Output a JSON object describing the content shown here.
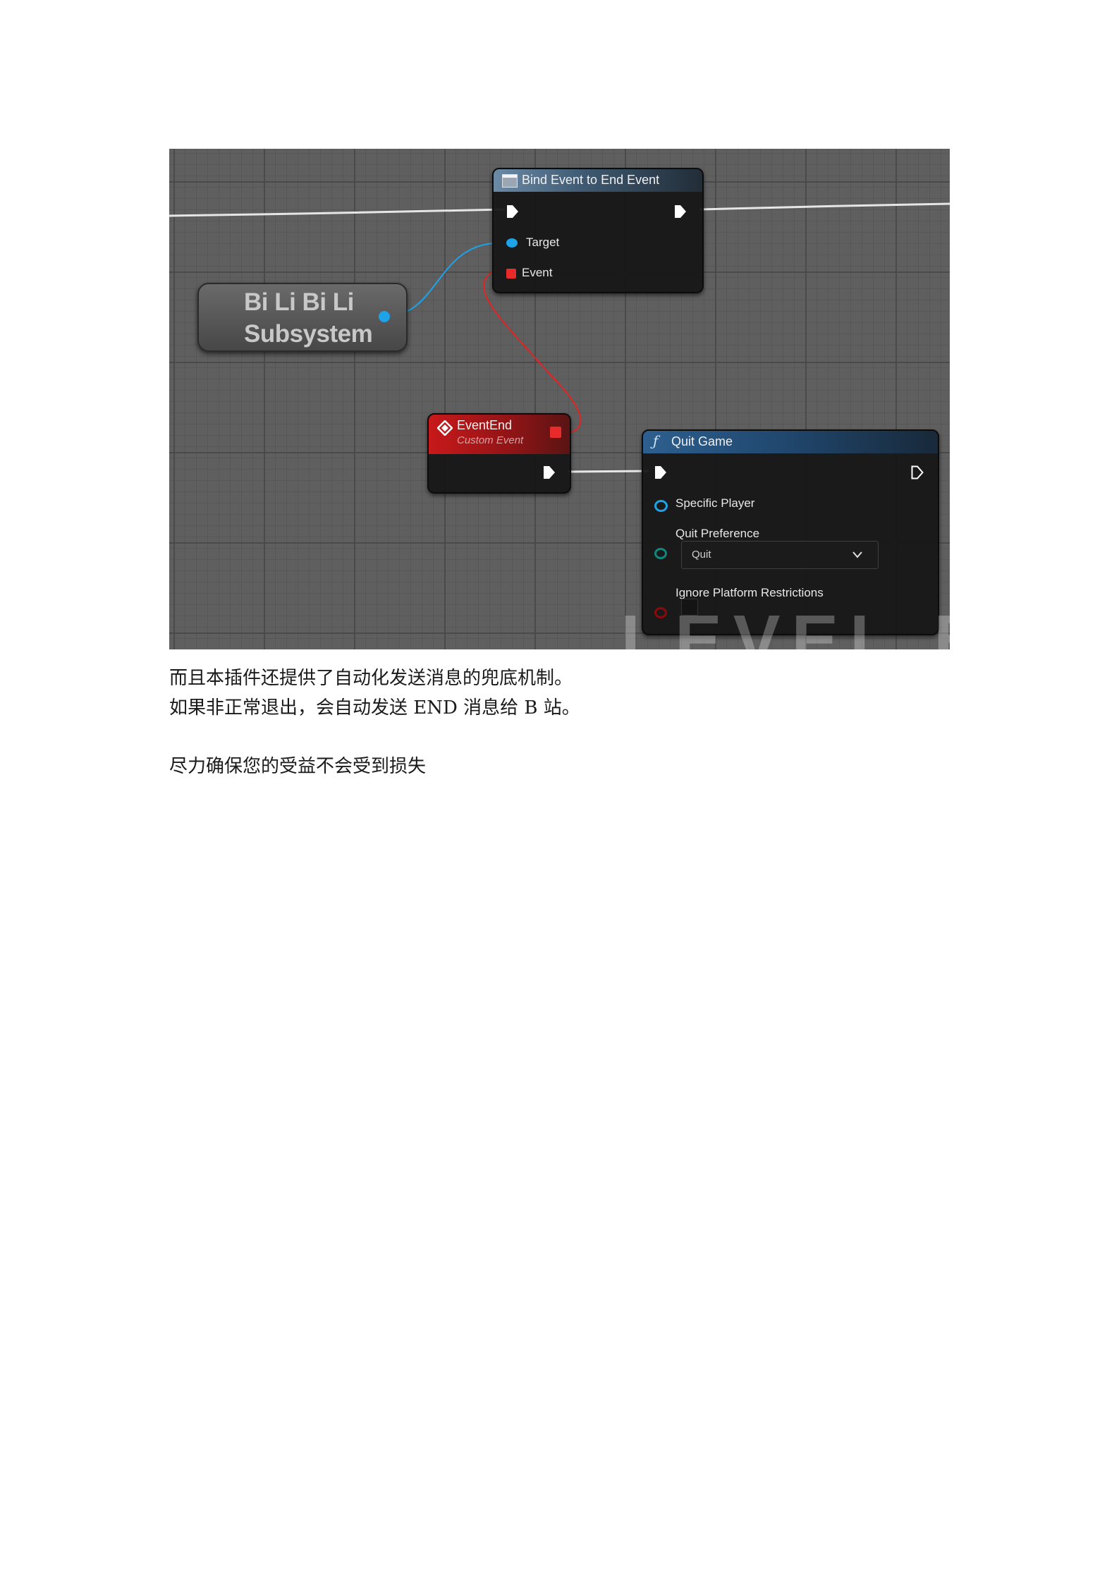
{
  "graph": {
    "subsystem_node": {
      "title": "Bi Li Bi Li Subsystem"
    },
    "bind_node": {
      "title": "Bind Event to End Event",
      "pins": {
        "target": "Target",
        "event": "Event"
      }
    },
    "event_node": {
      "title": "EventEnd",
      "subtitle": "Custom Event"
    },
    "quit_node": {
      "title": "Quit Game",
      "pins": {
        "specific_player": "Specific Player",
        "quit_preference": "Quit Preference",
        "quit_preference_value": "Quit",
        "ignore_platform": "Ignore Platform Restrictions"
      }
    },
    "watermark": "LEVEL BLU",
    "colors": {
      "object_pin": "#1ea2e8",
      "delegate_pin": "#e82a2a",
      "enum_pin": "#0c8a7d",
      "bool_pin": "#8b0a0a",
      "exec_pin": "#ffffff"
    }
  },
  "document": {
    "line1": "而且本插件还提供了自动化发送消息的兜底机制。",
    "line2": "如果非正常退出，会自动发送 END 消息给 B 站。",
    "line3": "尽力确保您的受益不会受到损失"
  }
}
